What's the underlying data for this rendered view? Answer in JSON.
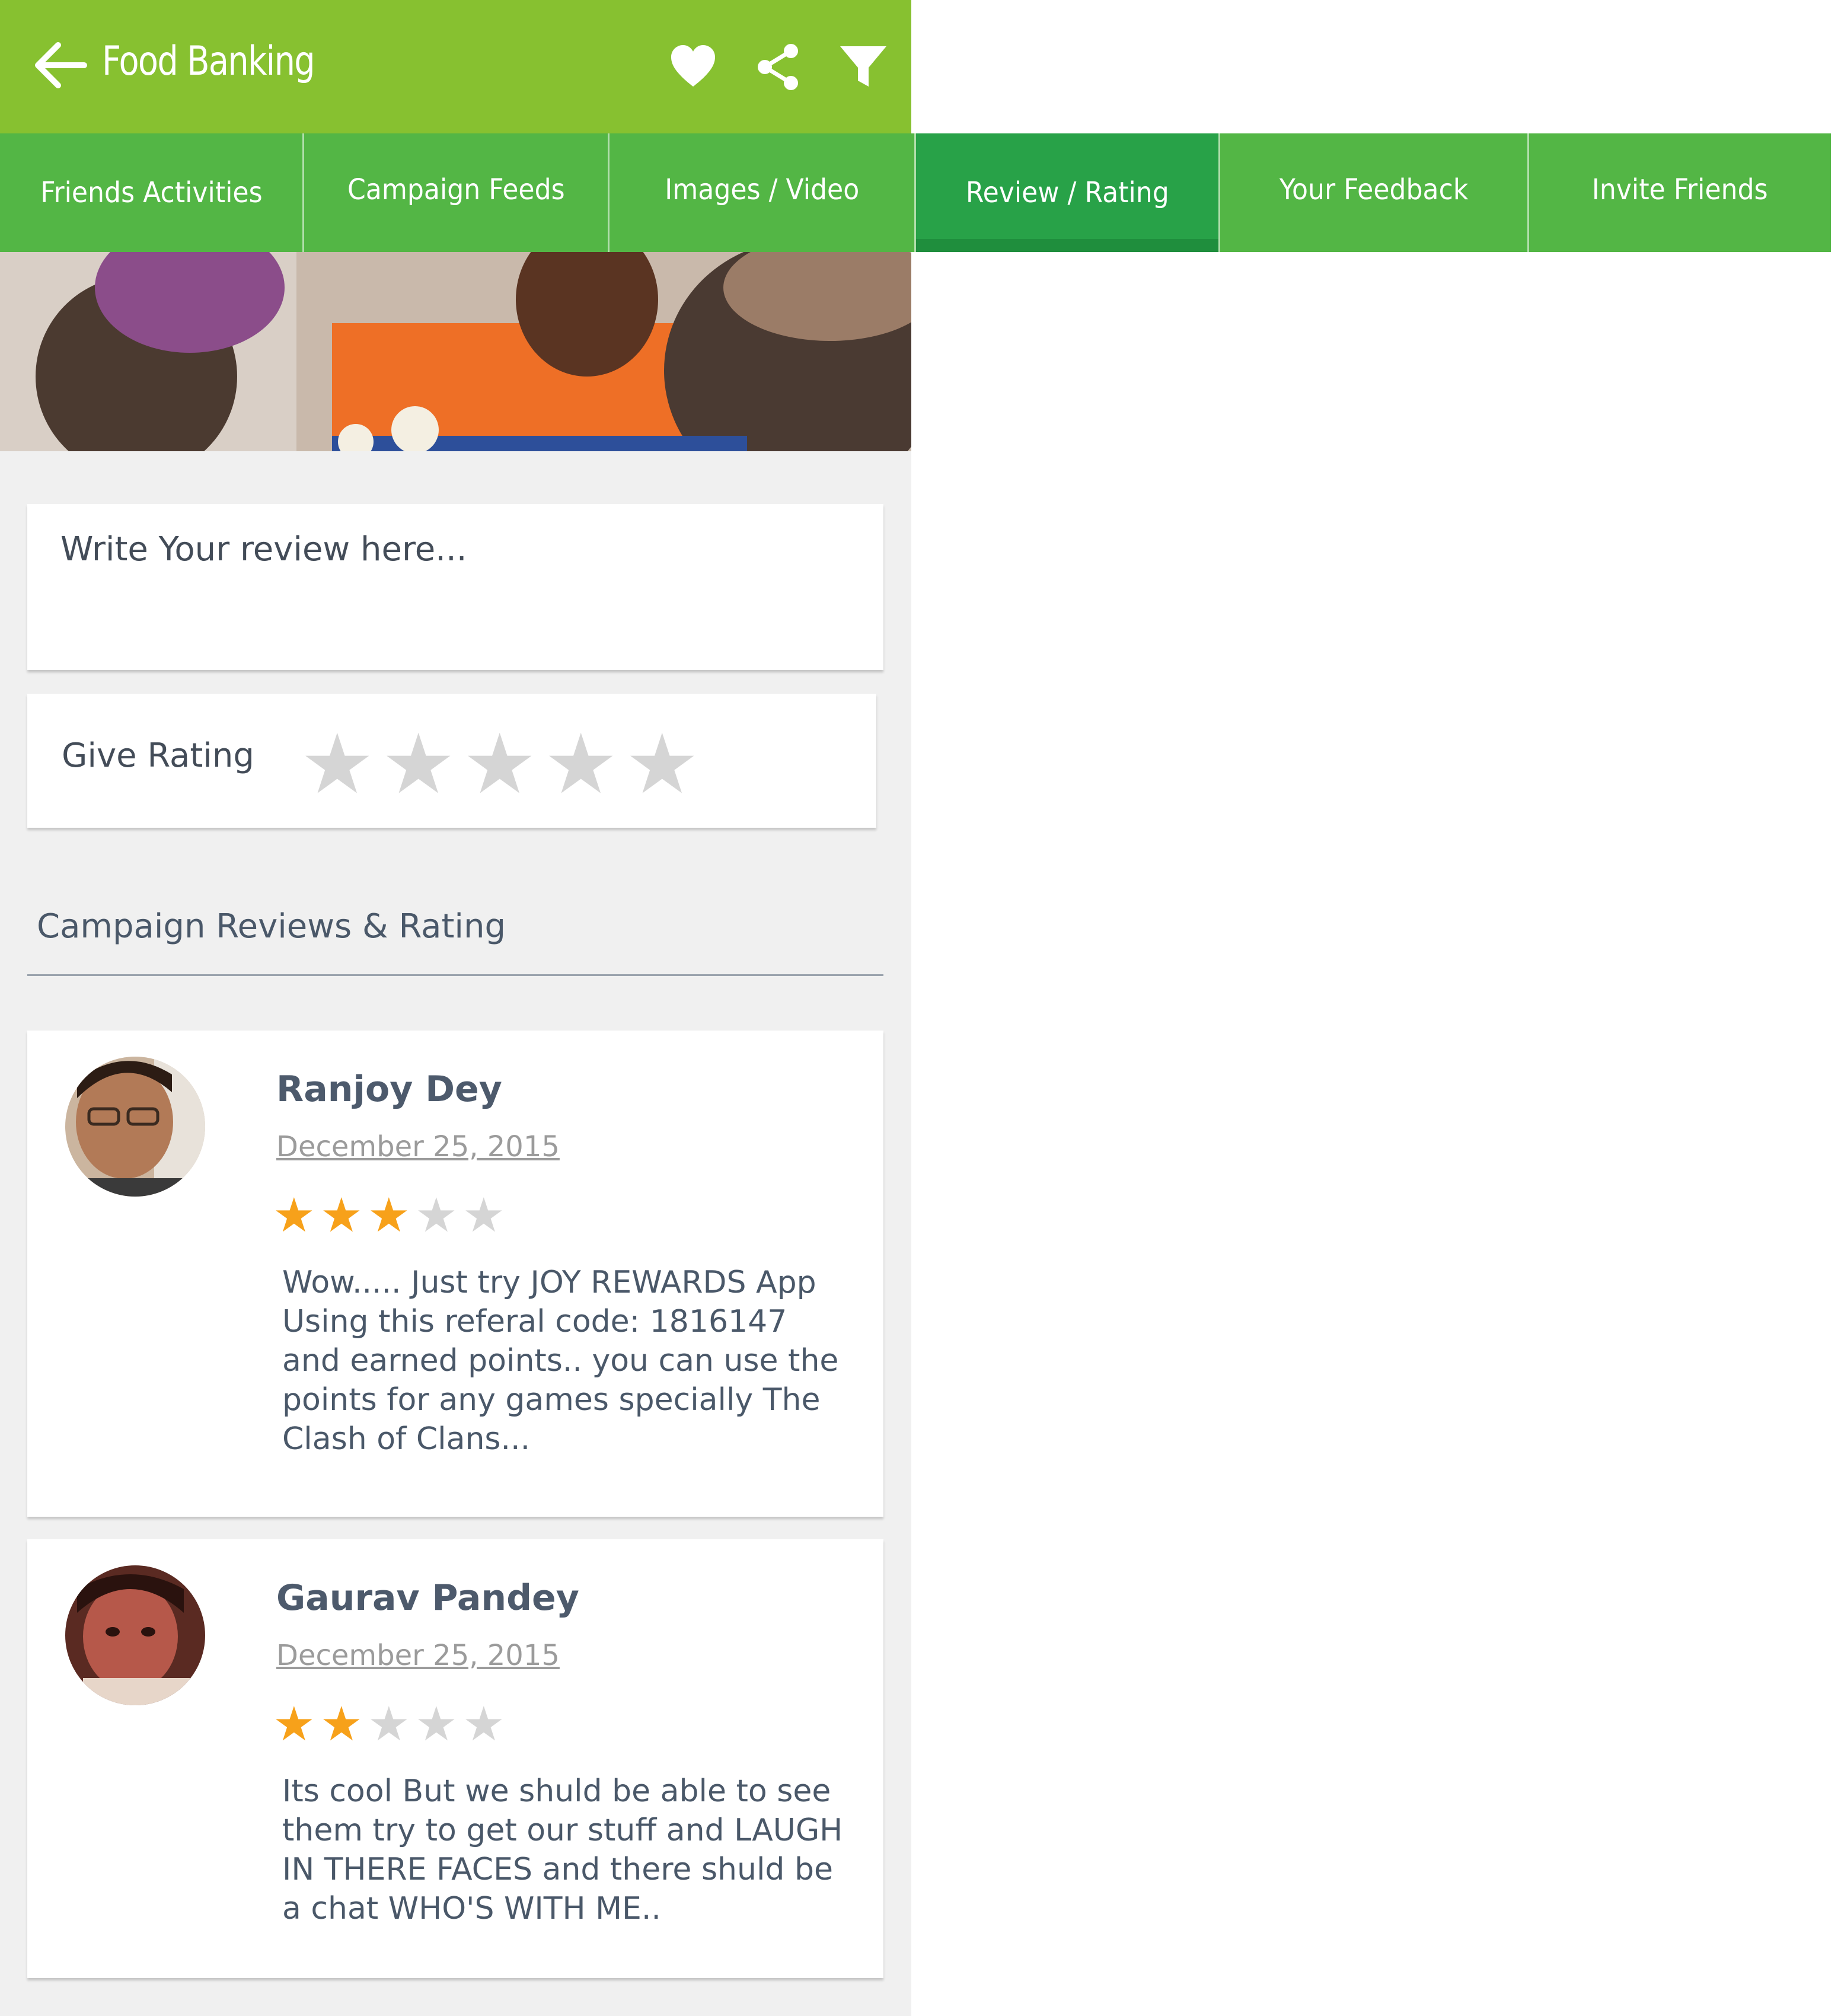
{
  "app": {
    "title": "Food Banking",
    "brand_color": "#87c130",
    "tab_color": "#53b645",
    "active_tab_color": "#28a248",
    "star_color": "#f7a11a",
    "actions": [
      "back-arrow-icon",
      "heart-icon",
      "share-icon",
      "filter-icon"
    ]
  },
  "tabs": [
    {
      "label": "Friends Activities",
      "active": false
    },
    {
      "label": "Campaign Feeds",
      "active": false
    },
    {
      "label": "Images / Video",
      "active": false
    },
    {
      "label": "Review / Rating",
      "active": true
    },
    {
      "label": "Your Feedback",
      "active": false
    },
    {
      "label": "Invite Friends",
      "active": false
    }
  ],
  "review_form": {
    "placeholder": "Write Your review here...",
    "rating_label": "Give Rating",
    "rating_value": 0,
    "rating_max": 5
  },
  "section": {
    "title": "Campaign Reviews & Rating"
  },
  "reviews": [
    {
      "name": "Ranjoy Dey",
      "date": "December 25, 2015",
      "rating": 3,
      "rating_max": 5,
      "text": "Wow..... Just try JOY REWARDS App Using this referal code: 1816147 and earned points.. you can use the points for any games specially The Clash of Clans..."
    },
    {
      "name": "Gaurav Pandey",
      "date": "December 25, 2015",
      "rating": 2,
      "rating_max": 5,
      "text": "Its cool But we shuld be able to see them try to get our stuff and LAUGH IN THERE FACES and there shuld be a chat WHO'S WITH ME.."
    }
  ]
}
